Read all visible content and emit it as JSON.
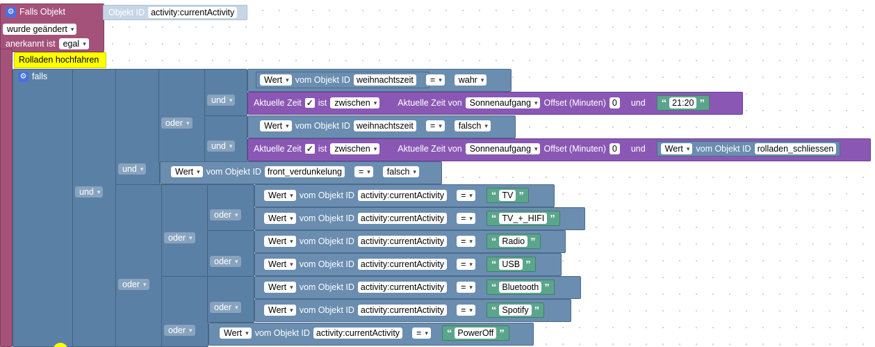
{
  "trigger": {
    "title": "Falls Objekt",
    "object_id_label": "Objekt ID",
    "object_id": "activity:currentActivity",
    "changed": "wurde geändert",
    "ack_label": "anerkannt ist",
    "ack": "egal"
  },
  "comment": "Rolladen hochfahren",
  "if_label": "falls",
  "ops": {
    "und": "und",
    "oder": "oder"
  },
  "value": {
    "wert": "Wert",
    "vom": "vom Objekt ID",
    "eq": "="
  },
  "time": {
    "aktuelle_zeit": "Aktuelle Zeit",
    "ist": "ist",
    "zwischen": "zwischen",
    "aktuelle_zeit_von": "Aktuelle Zeit von",
    "sonnenaufgang": "Sonnenaufgang",
    "offset": "Offset (Minuten)",
    "offset_val": "0",
    "und": "und",
    "time_end": "21:20"
  },
  "conds": {
    "weihnachtszeit": "weihnachtszeit",
    "wahr": "wahr",
    "falsch": "falsch",
    "rolladen": "rolladen_schliessen",
    "front": "front_verdunkelung",
    "act": "activity:currentActivity"
  },
  "activities": {
    "a1": "TV",
    "a2": "TV_+_HIFI",
    "a3": "Radio",
    "a4": "USB",
    "a5": "Bluetooth",
    "a6": "Spotify",
    "a7": "PowerOff"
  },
  "colors": {
    "event": "#a5527b",
    "logic": "#5b80a5",
    "time": "#8a58b4",
    "text": "#5ba58c",
    "comment": "#ffff00"
  }
}
